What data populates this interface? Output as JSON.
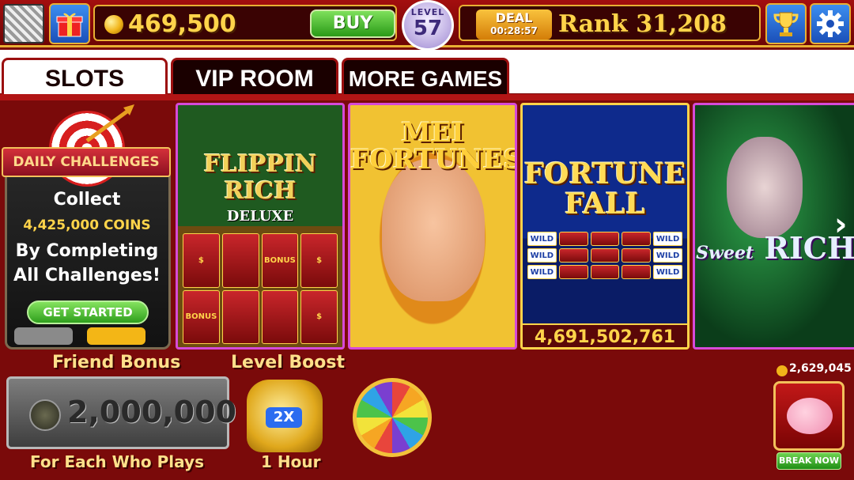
{
  "header": {
    "coins": "469,500",
    "buy_label": "BUY",
    "level_label": "LEVEL",
    "level_value": "57",
    "deal_label": "DEAL",
    "deal_timer": "00:28:57",
    "rank_text": "Rank 31,208"
  },
  "tabs": [
    {
      "label": "SLOTS",
      "active": true
    },
    {
      "label": "VIP ROOM",
      "active": false
    },
    {
      "label": "MORE GAMES",
      "active": false
    }
  ],
  "daily_challenges": {
    "ribbon": "DAILY CHALLENGES",
    "collect": "Collect",
    "coins": "4,425,000 COINS",
    "line1": "By Completing",
    "line2": "All Challenges!",
    "button": "GET STARTED"
  },
  "games": [
    {
      "title_line1": "FLIPPIN",
      "title_line2": "RICH",
      "subtitle": "DELUXE",
      "symbols": [
        "$",
        "BONUS",
        "BONUS",
        "$"
      ]
    },
    {
      "title_line1": "MEI",
      "title_line2": "FORTUNES"
    },
    {
      "title_line1": "FORTUNE",
      "title_line2": "FALL",
      "jackpot": "4,691,502,761",
      "wild": "WILD"
    },
    {
      "title": "RICH",
      "title_script": "Sweet"
    }
  ],
  "bottom": {
    "friend_title": "Friend Bonus",
    "friend_value": "2,000,000",
    "friend_sub": "For Each Who Plays",
    "boost_title": "Level Boost",
    "boost_mult": "2X",
    "boost_sub": "1 Hour",
    "bank_value": "2,629,045",
    "break_label": "BREAK NOW"
  },
  "colors": {
    "background": "#7a0a0a",
    "gold": "#ffd44a",
    "accent_blue": "#1b4fb8",
    "accent_green": "#2a9a17"
  },
  "icons": [
    "gift-icon",
    "coin-icon",
    "trophy-icon",
    "gear-icon",
    "target-icon",
    "piggy-bank-icon",
    "prize-wheel-icon",
    "money-bag-icon",
    "chevron-right-icon"
  ]
}
